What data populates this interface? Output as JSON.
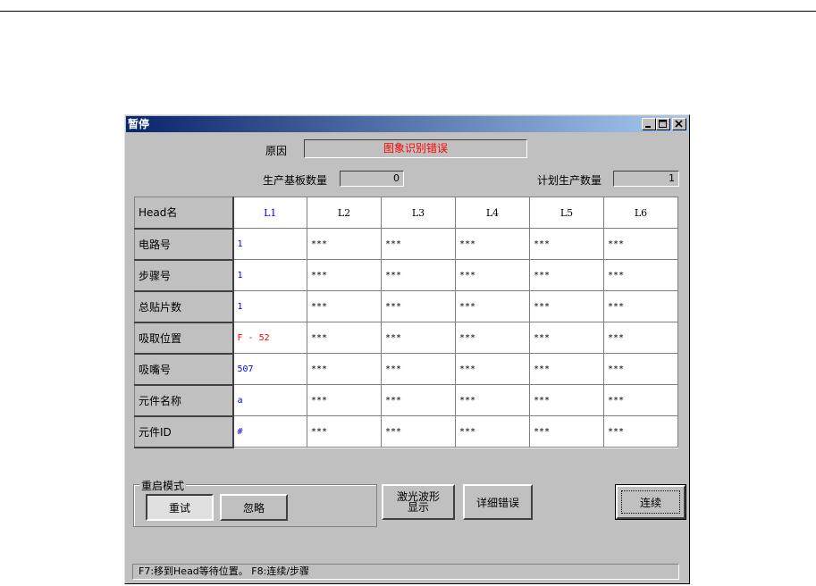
{
  "dialog": {
    "title": "暂停",
    "reason_label": "原因",
    "reason_value": "图象识别错误",
    "board_count_label": "生产基板数量",
    "board_count_value": "0",
    "plan_count_label": "计划生产数量",
    "plan_count_value": "1"
  },
  "table": {
    "corner": "Head名",
    "columns": [
      "L1",
      "L2",
      "L3",
      "L4",
      "L5",
      "L6"
    ],
    "rows": [
      {
        "label": "电路号",
        "values": [
          "1",
          "***",
          "***",
          "***",
          "***",
          "***"
        ]
      },
      {
        "label": "步骤号",
        "values": [
          "1",
          "***",
          "***",
          "***",
          "***",
          "***"
        ]
      },
      {
        "label": "总贴片数",
        "values": [
          "1",
          "***",
          "***",
          "***",
          "***",
          "***"
        ]
      },
      {
        "label": "吸取位置",
        "values": [
          "F - 52",
          "***",
          "***",
          "***",
          "***",
          "***"
        ]
      },
      {
        "label": "吸嘴号",
        "values": [
          "507",
          "***",
          "***",
          "***",
          "***",
          "***"
        ]
      },
      {
        "label": "元件名称",
        "values": [
          "a",
          "***",
          "***",
          "***",
          "***",
          "***"
        ]
      },
      {
        "label": "元件ID",
        "values": [
          "#",
          "***",
          "***",
          "***",
          "***",
          "***"
        ]
      }
    ]
  },
  "restart": {
    "group_label": "重启模式",
    "retry_label": "重试",
    "ignore_label": "忽略"
  },
  "buttons": {
    "laser_line1": "激光波形",
    "laser_line2": "显示",
    "detail_error": "详细错误",
    "continue": "连续"
  },
  "status_text": "F7:移到Head等待位置。  F8:连续/步骤",
  "colors": {
    "title_start": "#0a246a",
    "title_end": "#a6caf0",
    "error_text": "#ff0000",
    "value_text": "#0000ff",
    "face": "#c0c0c0"
  },
  "icons": [
    "minimize-icon",
    "maximize-icon",
    "close-icon"
  ]
}
